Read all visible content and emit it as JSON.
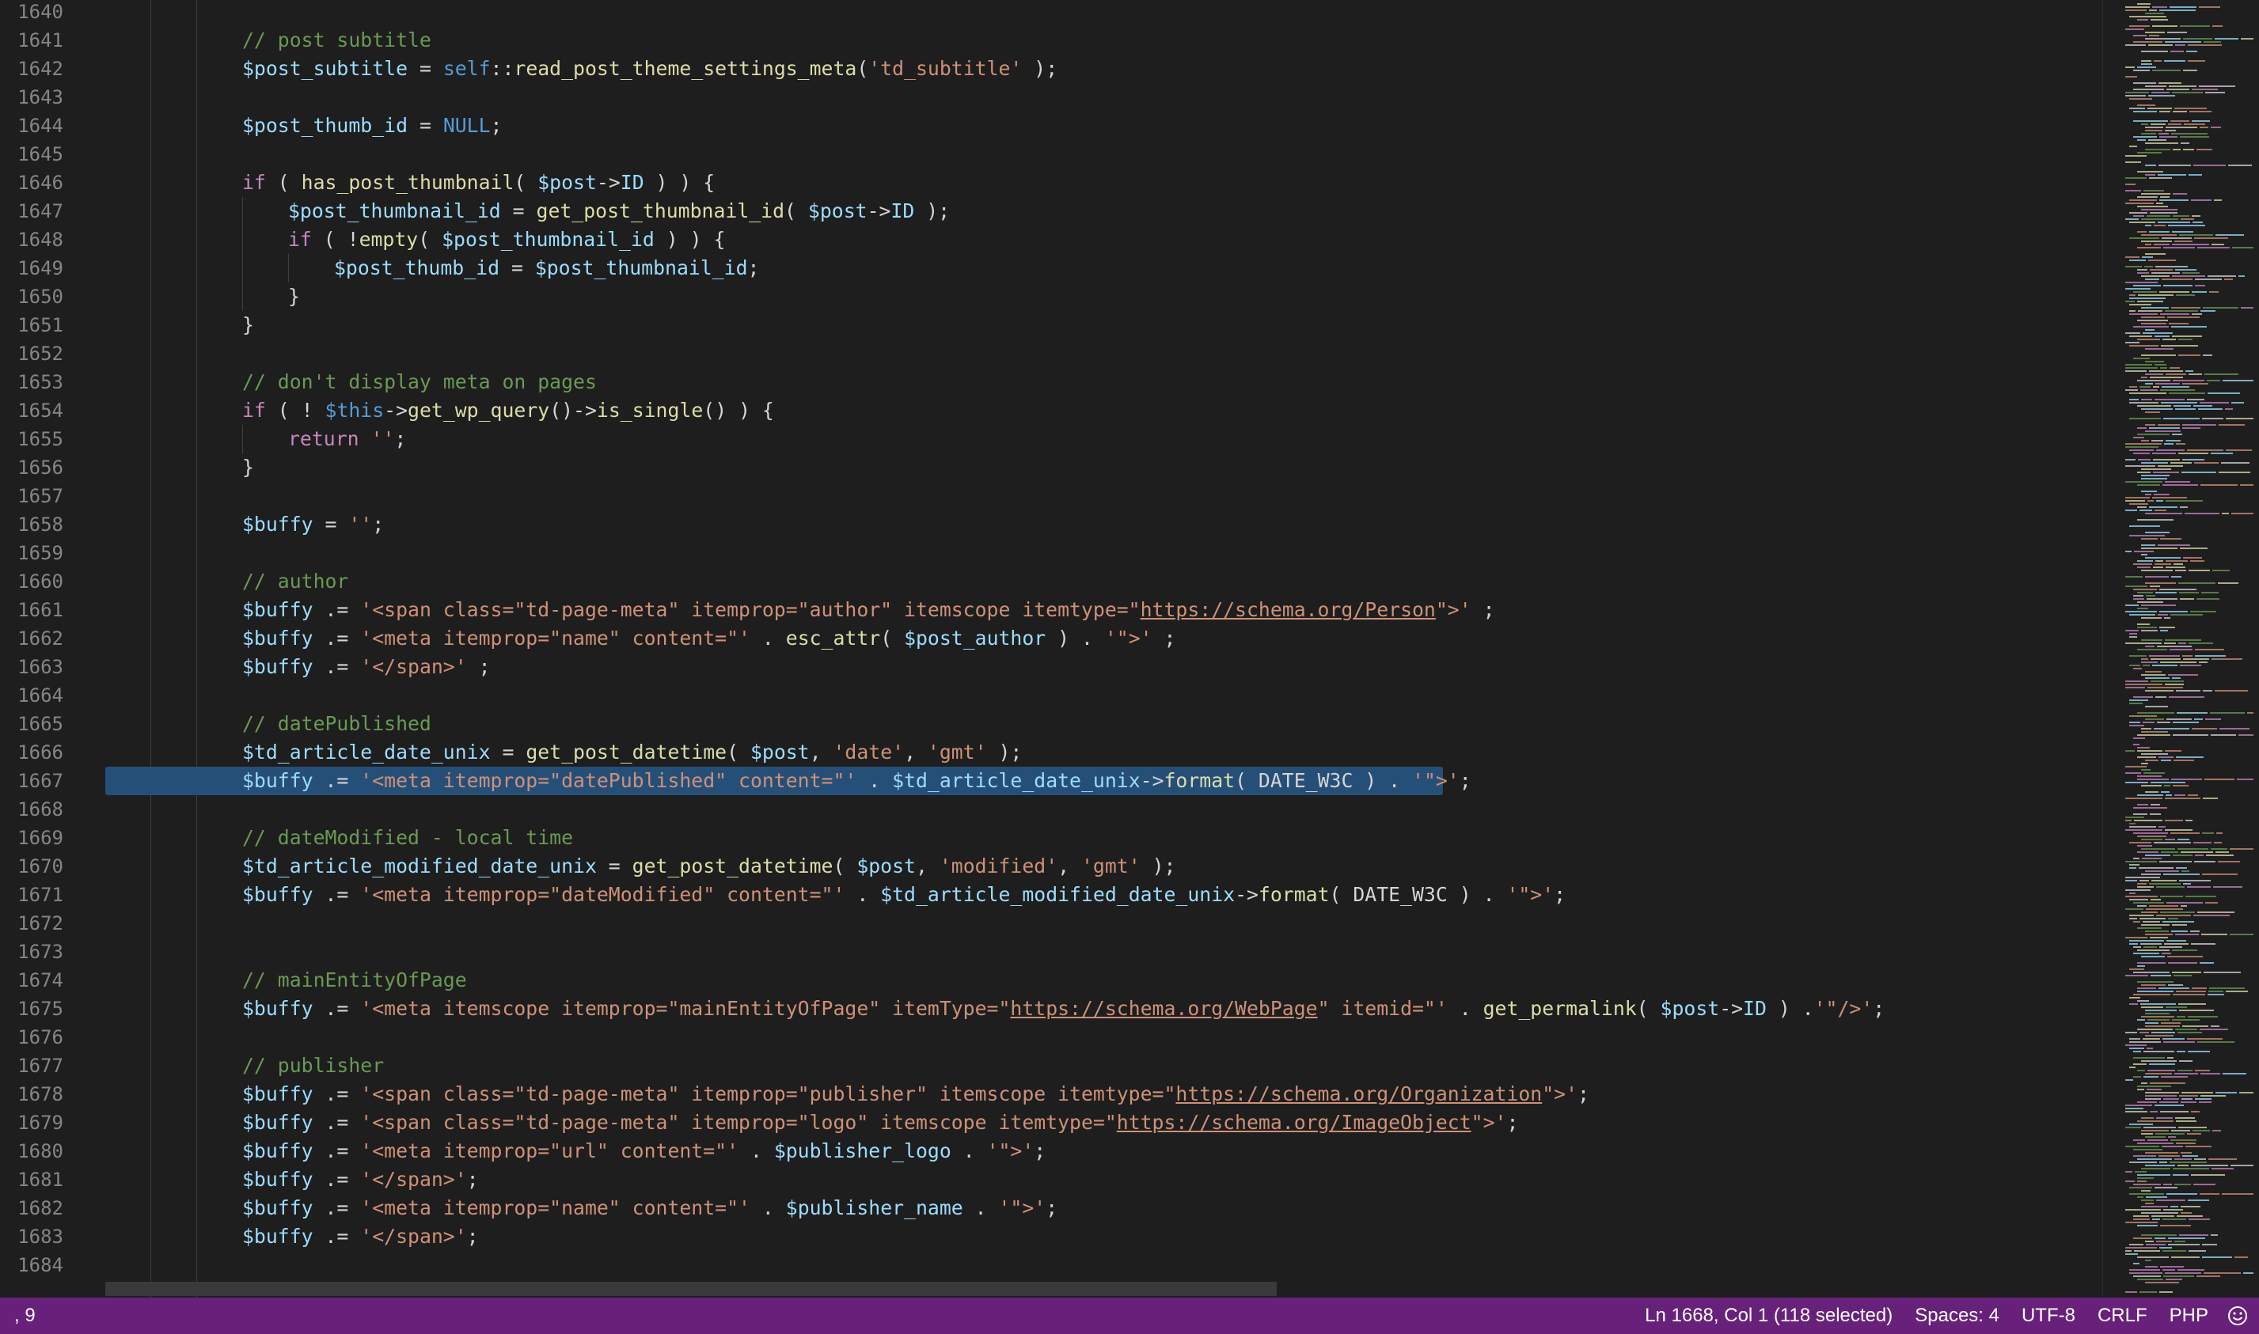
{
  "editor": {
    "first_line": 1640,
    "selected_line": 1667,
    "lines": [
      {
        "n": "1640",
        "indent": 0,
        "tokens": []
      },
      {
        "n": "1641",
        "indent": 1,
        "tokens": [
          [
            "c",
            "// post subtitle"
          ]
        ]
      },
      {
        "n": "1642",
        "indent": 1,
        "tokens": [
          [
            "v",
            "$post_subtitle"
          ],
          [
            "p",
            " = "
          ],
          [
            "b",
            "self"
          ],
          [
            "p",
            "::"
          ],
          [
            "f",
            "read_post_theme_settings_meta"
          ],
          [
            "p",
            "("
          ],
          [
            "s",
            "'td_subtitle'"
          ],
          [
            "p",
            " );"
          ]
        ]
      },
      {
        "n": "1643",
        "indent": 0,
        "tokens": []
      },
      {
        "n": "1644",
        "indent": 1,
        "tokens": [
          [
            "v",
            "$post_thumb_id"
          ],
          [
            "p",
            " = "
          ],
          [
            "b",
            "NULL"
          ],
          [
            "p",
            ";"
          ]
        ]
      },
      {
        "n": "1645",
        "indent": 0,
        "tokens": []
      },
      {
        "n": "1646",
        "indent": 1,
        "tokens": [
          [
            "k",
            "if"
          ],
          [
            "p",
            " ( "
          ],
          [
            "f",
            "has_post_thumbnail"
          ],
          [
            "p",
            "( "
          ],
          [
            "v",
            "$post"
          ],
          [
            "p",
            "->"
          ],
          [
            "v",
            "ID"
          ],
          [
            "p",
            " ) ) {"
          ]
        ]
      },
      {
        "n": "1647",
        "indent": 2,
        "tokens": [
          [
            "v",
            "$post_thumbnail_id"
          ],
          [
            "p",
            " = "
          ],
          [
            "f",
            "get_post_thumbnail_id"
          ],
          [
            "p",
            "( "
          ],
          [
            "v",
            "$post"
          ],
          [
            "p",
            "->"
          ],
          [
            "v",
            "ID"
          ],
          [
            "p",
            " );"
          ]
        ]
      },
      {
        "n": "1648",
        "indent": 2,
        "tokens": [
          [
            "k",
            "if"
          ],
          [
            "p",
            " ( !"
          ],
          [
            "f",
            "empty"
          ],
          [
            "p",
            "( "
          ],
          [
            "v",
            "$post_thumbnail_id"
          ],
          [
            "p",
            " ) ) {"
          ]
        ]
      },
      {
        "n": "1649",
        "indent": 3,
        "tokens": [
          [
            "v",
            "$post_thumb_id"
          ],
          [
            "p",
            " = "
          ],
          [
            "v",
            "$post_thumbnail_id"
          ],
          [
            "p",
            ";"
          ]
        ]
      },
      {
        "n": "1650",
        "indent": 2,
        "tokens": [
          [
            "p",
            "}"
          ]
        ]
      },
      {
        "n": "1651",
        "indent": 1,
        "tokens": [
          [
            "p",
            "}"
          ]
        ]
      },
      {
        "n": "1652",
        "indent": 0,
        "tokens": []
      },
      {
        "n": "1653",
        "indent": 1,
        "tokens": [
          [
            "c",
            "// don't display meta on pages"
          ]
        ]
      },
      {
        "n": "1654",
        "indent": 1,
        "tokens": [
          [
            "k",
            "if"
          ],
          [
            "p",
            " ( ! "
          ],
          [
            "b",
            "$this"
          ],
          [
            "p",
            "->"
          ],
          [
            "f",
            "get_wp_query"
          ],
          [
            "p",
            "()->"
          ],
          [
            "f",
            "is_single"
          ],
          [
            "p",
            "() ) {"
          ]
        ]
      },
      {
        "n": "1655",
        "indent": 2,
        "tokens": [
          [
            "k",
            "return"
          ],
          [
            "p",
            " "
          ],
          [
            "s",
            "''"
          ],
          [
            "p",
            ";"
          ]
        ]
      },
      {
        "n": "1656",
        "indent": 1,
        "tokens": [
          [
            "p",
            "}"
          ]
        ]
      },
      {
        "n": "1657",
        "indent": 0,
        "tokens": []
      },
      {
        "n": "1658",
        "indent": 1,
        "tokens": [
          [
            "v",
            "$buffy"
          ],
          [
            "p",
            " = "
          ],
          [
            "s",
            "''"
          ],
          [
            "p",
            ";"
          ]
        ]
      },
      {
        "n": "1659",
        "indent": 0,
        "tokens": []
      },
      {
        "n": "1660",
        "indent": 1,
        "tokens": [
          [
            "c",
            "// author"
          ]
        ]
      },
      {
        "n": "1661",
        "indent": 1,
        "tokens": [
          [
            "v",
            "$buffy"
          ],
          [
            "p",
            " .= "
          ],
          [
            "s",
            "'<span class=\"td-page-meta\" itemprop=\"author\" itemscope itemtype=\""
          ],
          [
            "u",
            "https://schema.org/Person"
          ],
          [
            "s",
            "\">'"
          ],
          [
            "p",
            " ;"
          ]
        ]
      },
      {
        "n": "1662",
        "indent": 1,
        "tokens": [
          [
            "v",
            "$buffy"
          ],
          [
            "p",
            " .= "
          ],
          [
            "s",
            "'<meta itemprop=\"name\" content=\"'"
          ],
          [
            "p",
            " . "
          ],
          [
            "f",
            "esc_attr"
          ],
          [
            "p",
            "( "
          ],
          [
            "v",
            "$post_author"
          ],
          [
            "p",
            " ) . "
          ],
          [
            "s",
            "'\">'"
          ],
          [
            "p",
            " ;"
          ]
        ]
      },
      {
        "n": "1663",
        "indent": 1,
        "tokens": [
          [
            "v",
            "$buffy"
          ],
          [
            "p",
            " .= "
          ],
          [
            "s",
            "'</span>'"
          ],
          [
            "p",
            " ;"
          ]
        ]
      },
      {
        "n": "1664",
        "indent": 0,
        "tokens": []
      },
      {
        "n": "1665",
        "indent": 1,
        "tokens": [
          [
            "c",
            "// datePublished"
          ]
        ]
      },
      {
        "n": "1666",
        "indent": 1,
        "tokens": [
          [
            "v",
            "$td_article_date_unix"
          ],
          [
            "p",
            " = "
          ],
          [
            "f",
            "get_post_datetime"
          ],
          [
            "p",
            "( "
          ],
          [
            "v",
            "$post"
          ],
          [
            "p",
            ", "
          ],
          [
            "s",
            "'date'"
          ],
          [
            "p",
            ", "
          ],
          [
            "s",
            "'gmt'"
          ],
          [
            "p",
            " );"
          ]
        ]
      },
      {
        "n": "1667",
        "indent": 1,
        "tokens": [
          [
            "v",
            "$buffy"
          ],
          [
            "p",
            " .= "
          ],
          [
            "s",
            "'<meta itemprop=\"datePublished\" content=\"'"
          ],
          [
            "p",
            " . "
          ],
          [
            "v",
            "$td_article_date_unix"
          ],
          [
            "p",
            "->"
          ],
          [
            "f",
            "format"
          ],
          [
            "p",
            "( DATE_W3C ) . "
          ],
          [
            "s",
            "'\">'"
          ],
          [
            "p",
            ";"
          ]
        ]
      },
      {
        "n": "1668",
        "indent": 0,
        "tokens": []
      },
      {
        "n": "1669",
        "indent": 1,
        "tokens": [
          [
            "c",
            "// dateModified - local time"
          ]
        ]
      },
      {
        "n": "1670",
        "indent": 1,
        "tokens": [
          [
            "v",
            "$td_article_modified_date_unix"
          ],
          [
            "p",
            " = "
          ],
          [
            "f",
            "get_post_datetime"
          ],
          [
            "p",
            "( "
          ],
          [
            "v",
            "$post"
          ],
          [
            "p",
            ", "
          ],
          [
            "s",
            "'modified'"
          ],
          [
            "p",
            ", "
          ],
          [
            "s",
            "'gmt'"
          ],
          [
            "p",
            " );"
          ]
        ]
      },
      {
        "n": "1671",
        "indent": 1,
        "tokens": [
          [
            "v",
            "$buffy"
          ],
          [
            "p",
            " .= "
          ],
          [
            "s",
            "'<meta itemprop=\"dateModified\" content=\"'"
          ],
          [
            "p",
            " . "
          ],
          [
            "v",
            "$td_article_modified_date_unix"
          ],
          [
            "p",
            "->"
          ],
          [
            "f",
            "format"
          ],
          [
            "p",
            "( DATE_W3C ) . "
          ],
          [
            "s",
            "'\">'"
          ],
          [
            "p",
            ";"
          ]
        ]
      },
      {
        "n": "1672",
        "indent": 0,
        "tokens": []
      },
      {
        "n": "1673",
        "indent": 0,
        "tokens": []
      },
      {
        "n": "1674",
        "indent": 1,
        "tokens": [
          [
            "c",
            "// mainEntityOfPage"
          ]
        ]
      },
      {
        "n": "1675",
        "indent": 1,
        "tokens": [
          [
            "v",
            "$buffy"
          ],
          [
            "p",
            " .= "
          ],
          [
            "s",
            "'<meta itemscope itemprop=\"mainEntityOfPage\" itemType=\""
          ],
          [
            "u",
            "https://schema.org/WebPage"
          ],
          [
            "s",
            "\" itemid=\"'"
          ],
          [
            "p",
            " . "
          ],
          [
            "f",
            "get_permalink"
          ],
          [
            "p",
            "( "
          ],
          [
            "v",
            "$post"
          ],
          [
            "p",
            "->"
          ],
          [
            "v",
            "ID"
          ],
          [
            "p",
            " ) ."
          ],
          [
            "s",
            "'\"/>'"
          ],
          [
            "p",
            ";"
          ]
        ]
      },
      {
        "n": "1676",
        "indent": 0,
        "tokens": []
      },
      {
        "n": "1677",
        "indent": 1,
        "tokens": [
          [
            "c",
            "// publisher"
          ]
        ]
      },
      {
        "n": "1678",
        "indent": 1,
        "tokens": [
          [
            "v",
            "$buffy"
          ],
          [
            "p",
            " .= "
          ],
          [
            "s",
            "'<span class=\"td-page-meta\" itemprop=\"publisher\" itemscope itemtype=\""
          ],
          [
            "u",
            "https://schema.org/Organization"
          ],
          [
            "s",
            "\">'"
          ],
          [
            "p",
            ";"
          ]
        ]
      },
      {
        "n": "1679",
        "indent": 1,
        "tokens": [
          [
            "v",
            "$buffy"
          ],
          [
            "p",
            " .= "
          ],
          [
            "s",
            "'<span class=\"td-page-meta\" itemprop=\"logo\" itemscope itemtype=\""
          ],
          [
            "u",
            "https://schema.org/ImageObject"
          ],
          [
            "s",
            "\">'"
          ],
          [
            "p",
            ";"
          ]
        ]
      },
      {
        "n": "1680",
        "indent": 1,
        "tokens": [
          [
            "v",
            "$buffy"
          ],
          [
            "p",
            " .= "
          ],
          [
            "s",
            "'<meta itemprop=\"url\" content=\"'"
          ],
          [
            "p",
            " . "
          ],
          [
            "v",
            "$publisher_logo"
          ],
          [
            "p",
            " . "
          ],
          [
            "s",
            "'\">'"
          ],
          [
            "p",
            ";"
          ]
        ]
      },
      {
        "n": "1681",
        "indent": 1,
        "tokens": [
          [
            "v",
            "$buffy"
          ],
          [
            "p",
            " .= "
          ],
          [
            "s",
            "'</span>'"
          ],
          [
            "p",
            ";"
          ]
        ]
      },
      {
        "n": "1682",
        "indent": 1,
        "tokens": [
          [
            "v",
            "$buffy"
          ],
          [
            "p",
            " .= "
          ],
          [
            "s",
            "'<meta itemprop=\"name\" content=\"'"
          ],
          [
            "p",
            " . "
          ],
          [
            "v",
            "$publisher_name"
          ],
          [
            "p",
            " . "
          ],
          [
            "s",
            "'\">'"
          ],
          [
            "p",
            ";"
          ]
        ]
      },
      {
        "n": "1683",
        "indent": 1,
        "tokens": [
          [
            "v",
            "$buffy"
          ],
          [
            "p",
            " .= "
          ],
          [
            "s",
            "'</span>'"
          ],
          [
            "p",
            ";"
          ]
        ]
      },
      {
        "n": "1684",
        "indent": 0,
        "tokens": []
      }
    ]
  },
  "statusbar": {
    "left_text": ", 9",
    "cursor": "Ln 1668, Col 1 (118 selected)",
    "spaces": "Spaces: 4",
    "encoding": "UTF-8",
    "eol": "CRLF",
    "language": "PHP",
    "feedback_icon": "smiley-feedback-icon"
  },
  "colors": {
    "background": "#1e1e1e",
    "statusbar": "#68217a",
    "selection": "#264f78",
    "comment": "#6a9955",
    "variable": "#9cdcfe",
    "function": "#dcdcaa",
    "string": "#ce9178",
    "keyword": "#c586c0",
    "constant": "#569cd6"
  }
}
